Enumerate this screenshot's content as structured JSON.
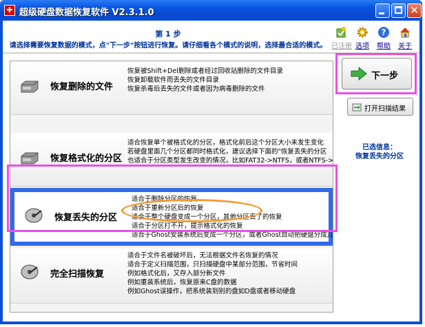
{
  "window": {
    "title": "超级硬盘数据恢复软件 V2.3.1.0"
  },
  "header": {
    "step_title": "第 1 步",
    "step_desc": "请选择需要恢复数据的模式，点\"下一步\"按钮进行恢复。请仔细看各个模式的说明，选择最合适的模式。"
  },
  "toolbar": {
    "register": "已注册",
    "options": "选项",
    "help": "帮助",
    "about": "关于"
  },
  "modes": [
    {
      "name": "恢复删除的文件",
      "desc": [
        "恢复被Shift+Del删除或者经过回收站删除的文件目录",
        "恢复卸载软件而丢失的文件目录",
        "恢复杀毒后丢失的文件或者因为病毒删除的文件"
      ]
    },
    {
      "name": "恢复格式化的分区",
      "desc": [
        "适合恢复单个被格式化的分区，格式化前后这个分区大小未发生变化",
        "若硬盘里面几个分区都同时格式化，建议选择下面的\"恢复丢失的分区",
        "也适合于分区类型发生改变的情况，比如FAT32->NTFS，或者NTFS->"
      ]
    },
    {
      "name": "恢复丢失的分区",
      "desc": [
        "适合于删除分区的恢复",
        "适合于重新分区后的恢复",
        "适合于整个硬盘变成一个分区，其他分区丢了的恢复",
        "适合于分区打不开，提示格式化的恢复",
        "适合于Ghost安装系统后变成一个分区，或者Ghost自动把硬盘分成几个"
      ]
    },
    {
      "name": "完全扫描恢复",
      "desc": [
        "适合于文件名被破坏后，无法根据文件名恢复的情况",
        "适合于定义扫描范围，只扫描硬盘中某部分范围，节省时间",
        "例如格式化后，又存入部分新文件",
        "例如重装系统后，恢复原来C盘的数据",
        "例如Ghost误操作，把系统装到别的盘如D盘或者移动硬盘"
      ]
    }
  ],
  "actions": {
    "next": "下一步",
    "open_scan": "打开扫描结果"
  },
  "selected_info": {
    "label": "已选信息：",
    "value": "恢复丢失的分区"
  },
  "colors": {
    "titlebar": "#0a4fd4",
    "selection": "#2f6be8",
    "highlight_pink": "#e84fe8",
    "highlight_orange": "#f39a3a",
    "info_text": "#003399"
  }
}
